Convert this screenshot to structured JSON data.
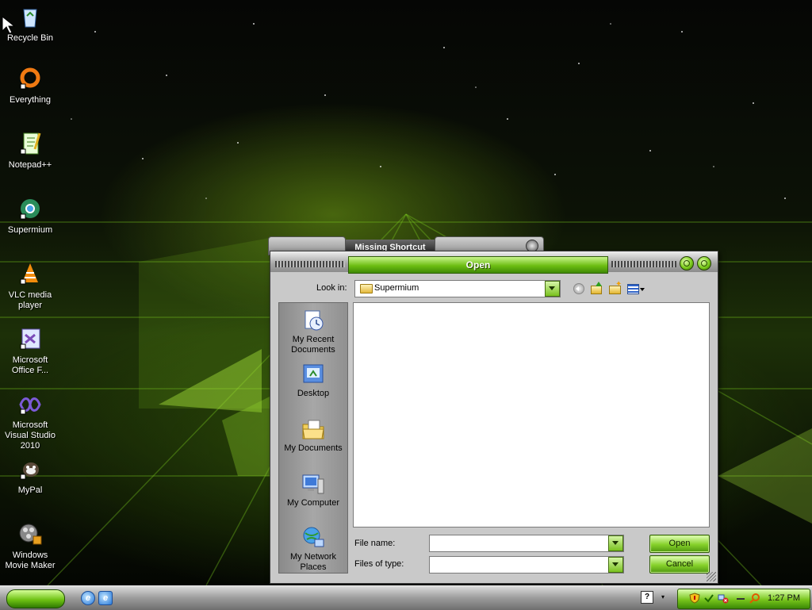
{
  "desktop": {
    "icons": [
      {
        "label": "Recycle Bin",
        "icon": "recycle-bin-icon"
      },
      {
        "label": "Everything",
        "icon": "everything-icon"
      },
      {
        "label": "Notepad++",
        "icon": "notepadpp-icon"
      },
      {
        "label": "Supermium",
        "icon": "supermium-icon"
      },
      {
        "label": "VLC media player",
        "icon": "vlc-icon"
      },
      {
        "label": "Microsoft Office F...",
        "icon": "office-icon"
      },
      {
        "label": "Microsoft Visual Studio 2010",
        "icon": "visual-studio-icon"
      },
      {
        "label": "MyPal",
        "icon": "mypal-icon"
      },
      {
        "label": "Windows Movie Maker",
        "icon": "movie-maker-icon"
      }
    ]
  },
  "back_window": {
    "title": "Missing Shortcut"
  },
  "dialog": {
    "title": "Open",
    "look_in_label": "Look in:",
    "look_in_value": "Supermium",
    "places": [
      {
        "label": "My Recent Documents",
        "icon": "recent-documents-icon"
      },
      {
        "label": "Desktop",
        "icon": "desktop-icon"
      },
      {
        "label": "My Documents",
        "icon": "my-documents-icon"
      },
      {
        "label": "My Computer",
        "icon": "my-computer-icon"
      },
      {
        "label": "My Network Places",
        "icon": "network-places-icon"
      }
    ],
    "file_name_label": "File name:",
    "file_name_value": "",
    "file_type_label": "Files of type:",
    "file_type_value": "",
    "open_label": "Open",
    "cancel_label": "Cancel"
  },
  "taskbar": {
    "clock": "1:27 PM"
  },
  "colors": {
    "accent_green": "#7ac21f",
    "dialog_body": "#c9c9c9",
    "title_dark": "#1c1c1c"
  }
}
